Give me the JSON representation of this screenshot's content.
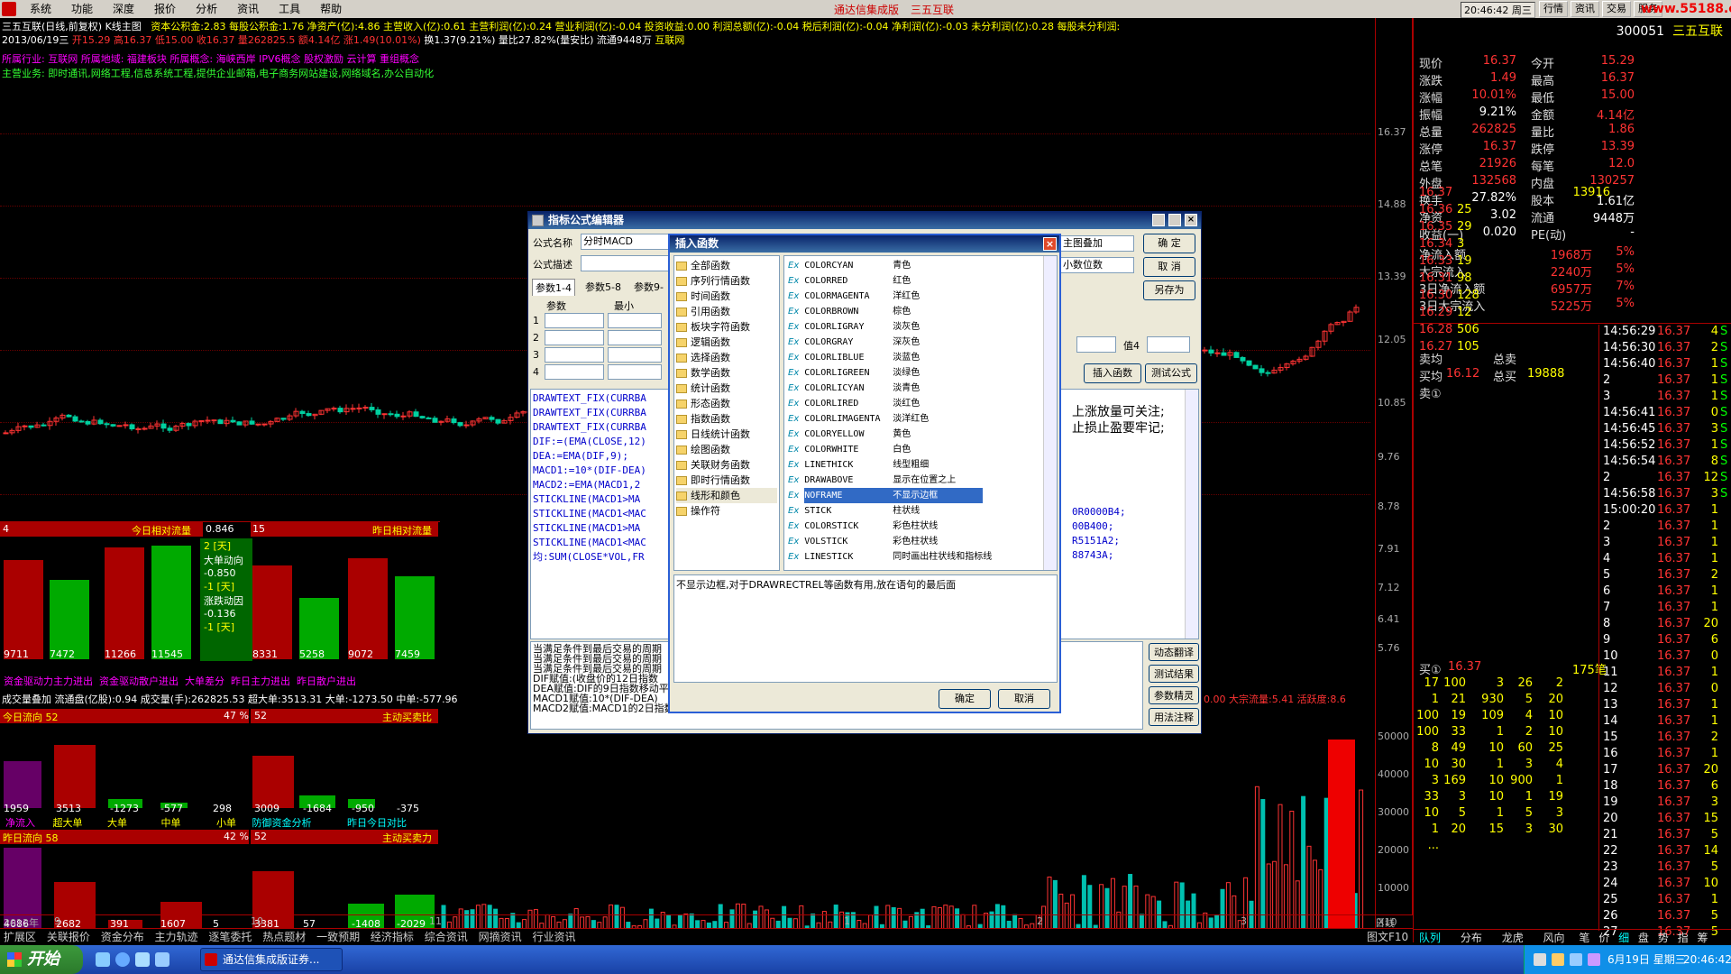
{
  "menubar": {
    "items": [
      "系统",
      "功能",
      "深度",
      "报价",
      "分析",
      "资讯",
      "工具",
      "帮助"
    ],
    "title": "通达信集成版",
    "stock": "三五互联",
    "clock": "20:46:42 周三",
    "buttons": [
      "行情",
      "资讯",
      "交易",
      "服务"
    ],
    "brand": "www.55188.com"
  },
  "header": {
    "line1_name": "三五互联(日线,前复权) K线主图",
    "line1_fin": "资本公积金:2.83 每股公积金:1.76 净资产(亿):4.86 主营收入(亿):0.61 主营利润(亿):0.24 营业利润(亿):-0.04 投资收益:0.00 利润总额(亿):-0.04 税后利润(亿):-0.04 净利润(亿):-0.03 未分利润(亿):0.28 每股未分利润:",
    "line2_date": "2013/06/19三",
    "line2_quote": "开15.29 高16.37 低15.00 收16.37 量262825.5 额4.14亿",
    "line2_chg": "涨1.49(10.01%)",
    "line2_rest": "换1.37(9.21%) 量比27.82%(量安比) 流通9448万",
    "line2_ind": "互联网",
    "line3": "所属行业: 互联网   所属地域: 福建板块   所属概念: 海峡西岸 IPV6概念 股权激励 云计算 重组概念",
    "line4": "主营业务: 即时通讯,网络工程,信息系统工程,提供企业邮箱,电子商务网站建设,网络域名,办公自动化",
    "price_axis": [
      "16.37",
      "14.88",
      "13.39",
      "12.05",
      "10.85",
      "9.76",
      "8.78",
      "7.91",
      "7.12",
      "6.41",
      "5.76"
    ],
    "vol_axis": [
      "50000",
      "40000",
      "30000",
      "20000",
      "10000",
      "X10"
    ],
    "date_axis": [
      "2012年",
      "9",
      "10",
      "11",
      "1",
      "2",
      "3",
      "4",
      "5",
      "6",
      "日线"
    ]
  },
  "lower_panels": {
    "p1": {
      "left_title": "今日相对流量",
      "left_val": "0.846",
      "left_num": "4",
      "right_num": "15",
      "right_title": "昨日相对流量",
      "bars": [
        "9711",
        "7472",
        "11266",
        "11545",
        "8331",
        "5258",
        "9072",
        "7459"
      ],
      "bars_labels": [
        "资金驱动力主力进出",
        "资金驱动散户进出",
        "大单差分",
        "昨日主力进出",
        "昨日散户进出"
      ],
      "mid": [
        "2 [天]",
        "大单动向",
        "-0.850",
        "-1 [天]",
        "涨跌动因",
        "-0.136",
        "-1 [天]"
      ]
    },
    "vol_line": "成交量叠加 流通盘(亿股):0.94 成交量(手):262825.53 超大单:3513.31 大单:-1273.50 中单:-577.96",
    "vol_line_right": "0.00 大宗流量:5.41 活跃度:8.6",
    "p2": {
      "title_left": "今日流向 52",
      "pct": "47 %",
      "title2": "52",
      "title_right": "主动买卖比",
      "vals": [
        "1959",
        "3513",
        "-1273",
        "-577",
        "298",
        "3009",
        "-1684",
        "-950",
        "-375"
      ],
      "labels": [
        "净流入",
        "超大单",
        "大单",
        "中单",
        "小单",
        "防御资金分析",
        "昨日今日对比"
      ]
    },
    "p3": {
      "title_left": "昨日流向 58",
      "pct": "42 %",
      "title2": "52",
      "title_right": "主动买卖力",
      "vals": [
        "4686",
        "2682",
        "391",
        "1607",
        "5",
        "3381",
        "57",
        "-1408",
        "-2029"
      ]
    }
  },
  "editor": {
    "title": "指标公式编辑器",
    "name_label": "公式名称",
    "name_value": "分时MACD",
    "desc_label": "公式描述",
    "tabs": [
      "参数1-4",
      "参数5-8",
      "参数9-"
    ],
    "param_cols": [
      "参数",
      "最小"
    ],
    "param_rows": [
      "1",
      "2",
      "3",
      "4"
    ],
    "right_combo1": "主图叠加",
    "right_combo2": "小数位数",
    "buttons": {
      "ok": "确 定",
      "cancel": "取 消",
      "save_as": "另存为",
      "insert": "插入函数",
      "test": "测试公式"
    },
    "val4_label": "值4",
    "note1": "上涨放量可关注;",
    "note2": "止损止盈要牢记;",
    "code_lines": [
      "DRAWTEXT_FIX(CURRBA",
      "DRAWTEXT_FIX(CURRBA",
      "DRAWTEXT_FIX(CURRBA",
      "",
      "DIF:=(EMA(CLOSE,12)",
      "DEA:=EMA(DIF,9);",
      "MACD1:=10*(DIF-DEA)",
      "MACD2:=EMA(MACD1,2",
      "STICKLINE(MACD1>MA",
      "STICKLINE(MACD1<MAC",
      "STICKLINE(MACD1>MA",
      "STICKLINE(MACD1<MAC",
      "均:SUM(CLOSE*VOL,FR"
    ],
    "code_right": [
      "0R0000B4;",
      "00B400;",
      "R5151A2;",
      "88743A;"
    ],
    "bottom_text": [
      "当满足条件到最后交易的周期",
      "当满足条件到最后交易的周期",
      "当满足条件到最后交易的周期",
      "DIF赋值:(收盘价的12日指数",
      "DEA赋值:DIF的9日指数移动平",
      "MACD1赋值:10*(DIF-DEA)",
      "MACD2赋值:MACD1的2日指数移动平均"
    ],
    "side_buttons": [
      "动态翻译",
      "测试结果",
      "参数精灵",
      "用法注释"
    ]
  },
  "insert_dialog": {
    "title": "插入函数",
    "categories": [
      "全部函数",
      "序列行情函数",
      "时间函数",
      "引用函数",
      "板块字符函数",
      "逻辑函数",
      "选择函数",
      "数学函数",
      "统计函数",
      "形态函数",
      "指数函数",
      "日线统计函数",
      "绘图函数",
      "关联财务函数",
      "即时行情函数",
      "线形和颜色",
      "操作符"
    ],
    "selected_category": "线形和颜色",
    "functions": [
      [
        "COLORCYAN",
        "青色"
      ],
      [
        "COLORRED",
        "红色"
      ],
      [
        "COLORMAGENTA",
        "洋红色"
      ],
      [
        "COLORBROWN",
        "棕色"
      ],
      [
        "COLORLIGRAY",
        "淡灰色"
      ],
      [
        "COLORGRAY",
        "深灰色"
      ],
      [
        "COLORLIBLUE",
        "淡蓝色"
      ],
      [
        "COLORLIGREEN",
        "淡绿色"
      ],
      [
        "COLORLICYAN",
        "淡青色"
      ],
      [
        "COLORLIRED",
        "淡红色"
      ],
      [
        "COLORLIMAGENTA",
        "淡洋红色"
      ],
      [
        "COLORYELLOW",
        "黄色"
      ],
      [
        "COLORWHITE",
        "白色"
      ],
      [
        "LINETHICK",
        "线型粗细"
      ],
      [
        "DRAWABOVE",
        "显示在位置之上"
      ],
      [
        "NOFRAME",
        "不显示边框"
      ],
      [
        "STICK",
        "柱状线"
      ],
      [
        "COLORSTICK",
        "彩色柱状线"
      ],
      [
        "VOLSTICK",
        "彩色柱状线"
      ],
      [
        "LINESTICK",
        "同时画出柱状线和指标线"
      ]
    ],
    "selected_function": "NOFRAME",
    "description": "不显示边框,对于DRAWRECTREL等函数有用,放在语句的最后面",
    "ok": "确定",
    "cancel": "取消"
  },
  "rpanel": {
    "code": "300051",
    "name": "三五互联",
    "quote": [
      [
        "现价",
        "16.37",
        "今开",
        "15.29"
      ],
      [
        "涨跌",
        "1.49",
        "最高",
        "16.37"
      ],
      [
        "涨幅",
        "10.01%",
        "最低",
        "15.00"
      ],
      [
        "振幅",
        "9.21%",
        "金额",
        "4.14亿"
      ],
      [
        "总量",
        "262825",
        "量比",
        "1.86"
      ],
      [
        "涨停",
        "16.37",
        "跌停",
        "13.39"
      ],
      [
        "总笔",
        "21926",
        "每笔",
        "12.0"
      ],
      [
        "外盘",
        "132568",
        "内盘",
        "130257"
      ]
    ],
    "misc": [
      [
        "换手",
        "27.82%",
        "股本",
        "1.61亿"
      ],
      [
        "净资",
        "3.02",
        "流通",
        "9448万"
      ],
      [
        "收益(一)",
        "0.020",
        "PE(动)",
        "-"
      ]
    ],
    "flows": [
      [
        "净流入额",
        "1968万",
        "5%"
      ],
      [
        "大宗流入",
        "2240万",
        "5%"
      ],
      [
        "3日净流入额",
        "6957万",
        "7%"
      ],
      [
        "3日大宗流入",
        "5225万",
        "5%"
      ]
    ],
    "depth": [
      [
        "16.37",
        "13916"
      ],
      [
        "16.36",
        "25"
      ],
      [
        "16.35",
        "29"
      ],
      [
        "16.34",
        "3"
      ],
      [
        "16.33",
        "19"
      ],
      [
        "16.31",
        "98"
      ],
      [
        "16.30",
        "128"
      ],
      [
        "16.29",
        "12"
      ],
      [
        "16.28",
        "506"
      ],
      [
        "16.27",
        "105"
      ]
    ],
    "avg": {
      "l1": "卖均",
      "l2": "买均",
      "l3": "卖①",
      "buy_avg": "16.12",
      "total_sell": "总卖",
      "total_buy": "总买",
      "total_buy_val": "19888"
    },
    "buy1": {
      "label": "买①",
      "price": "16.37",
      "vol": "175笔"
    },
    "queue": [
      [
        "17",
        "100",
        "3",
        "26",
        "2"
      ],
      [
        "1",
        "21",
        "930",
        "5",
        "20"
      ],
      [
        "100",
        "19",
        "109",
        "4",
        "10"
      ],
      [
        "100",
        "33",
        "1",
        "2",
        "10"
      ],
      [
        "8",
        "49",
        "10",
        "60",
        "25"
      ],
      [
        "10",
        "30",
        "1",
        "3",
        "4"
      ],
      [
        "3",
        "169",
        "10",
        "900",
        "1"
      ],
      [
        "33",
        "3",
        "10",
        "1",
        "19"
      ],
      [
        "10",
        "5",
        "1",
        "5",
        "3"
      ],
      [
        "1",
        "20",
        "15",
        "3",
        "30"
      ],
      [
        "...",
        "",
        "",
        "",
        ""
      ]
    ],
    "ticks": [
      [
        "14:56:29",
        "16.37",
        "4",
        "S"
      ],
      [
        "14:56:30",
        "16.37",
        "2",
        "S"
      ],
      [
        "14:56:40",
        "16.37",
        "1",
        "S"
      ],
      [
        "2",
        "16.37",
        "1",
        "S"
      ],
      [
        "3",
        "16.37",
        "1",
        "S"
      ],
      [
        "14:56:41",
        "16.37",
        "0",
        "S"
      ],
      [
        "14:56:45",
        "16.37",
        "3",
        "S"
      ],
      [
        "14:56:52",
        "16.37",
        "1",
        "S"
      ],
      [
        "14:56:54",
        "16.37",
        "8",
        "S"
      ],
      [
        "2",
        "16.37",
        "12",
        "S"
      ],
      [
        "14:56:58",
        "16.37",
        "3",
        "S"
      ],
      [
        "15:00:20",
        "16.37",
        "1",
        ""
      ],
      [
        "2",
        "16.37",
        "1",
        ""
      ],
      [
        "3",
        "16.37",
        "1",
        ""
      ],
      [
        "4",
        "16.37",
        "1",
        ""
      ],
      [
        "5",
        "16.37",
        "2",
        ""
      ],
      [
        "6",
        "16.37",
        "1",
        ""
      ],
      [
        "7",
        "16.37",
        "1",
        ""
      ],
      [
        "8",
        "16.37",
        "20",
        ""
      ],
      [
        "9",
        "16.37",
        "6",
        ""
      ],
      [
        "10",
        "16.37",
        "0",
        ""
      ],
      [
        "11",
        "16.37",
        "1",
        ""
      ],
      [
        "12",
        "16.37",
        "0",
        ""
      ],
      [
        "13",
        "16.37",
        "1",
        ""
      ],
      [
        "14",
        "16.37",
        "1",
        ""
      ],
      [
        "15",
        "16.37",
        "2",
        ""
      ],
      [
        "16",
        "16.37",
        "1",
        ""
      ],
      [
        "17",
        "16.37",
        "20",
        ""
      ],
      [
        "18",
        "16.37",
        "6",
        ""
      ],
      [
        "19",
        "16.37",
        "3",
        ""
      ],
      [
        "20",
        "16.37",
        "15",
        ""
      ],
      [
        "21",
        "16.37",
        "5",
        ""
      ],
      [
        "22",
        "16.37",
        "14",
        ""
      ],
      [
        "23",
        "16.37",
        "5",
        ""
      ],
      [
        "24",
        "16.37",
        "10",
        ""
      ],
      [
        "25",
        "16.37",
        "1",
        ""
      ],
      [
        "26",
        "16.37",
        "5",
        ""
      ],
      [
        "27",
        "16.37",
        "5",
        ""
      ]
    ],
    "bottom_tabs": [
      "队列",
      "分布",
      "龙虎",
      "风向",
      "笔",
      "价",
      "细",
      "盘",
      "势",
      "指",
      "筹"
    ]
  },
  "tabs_bar": [
    "扩展区",
    "关联报价",
    "资金分布",
    "主力轨迹",
    "逐笔委托",
    "热点题材",
    "一致预期",
    "经济指标",
    "综合资讯",
    "网摘资讯",
    "行业资讯"
  ],
  "tabs_bar_right": "图文F10",
  "taskbar": {
    "start": "开始",
    "task": "通达信集成版证券...",
    "tray_date": "6月19日 星期三",
    "tray_time": "20:46:42"
  },
  "colors": {
    "up": "#ff3333",
    "down": "#00cc99",
    "bg": "#000000",
    "title_blue": "#0a246a"
  }
}
